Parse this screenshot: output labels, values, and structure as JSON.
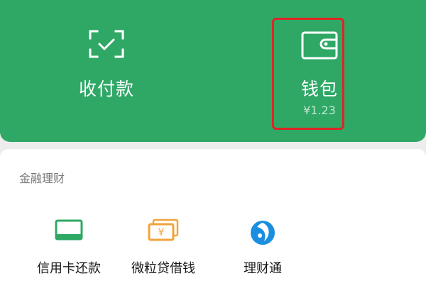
{
  "top": {
    "receive_pay": {
      "label": "收付款",
      "icon": "scan-icon"
    },
    "wallet": {
      "label": "钱包",
      "balance": "¥1.23",
      "icon": "wallet-icon"
    }
  },
  "finance": {
    "title": "金融理财",
    "items": [
      {
        "label": "信用卡还款",
        "icon": "credit-card-icon"
      },
      {
        "label": "微粒贷借钱",
        "icon": "yuan-bill-icon"
      },
      {
        "label": "理财通",
        "icon": "licaitong-icon"
      }
    ]
  },
  "colors": {
    "brand_green": "#2fa866",
    "highlight_red": "#e02424",
    "icon_green": "#2fa866",
    "icon_orange": "#f2a33a",
    "icon_blue": "#1a8fe0"
  }
}
